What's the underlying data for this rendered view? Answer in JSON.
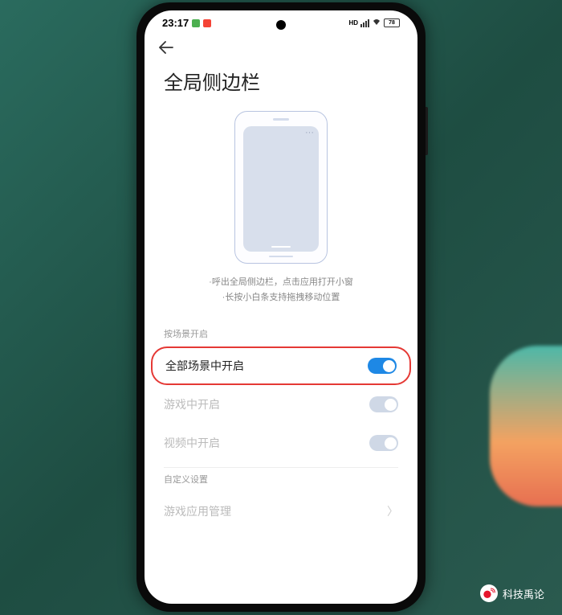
{
  "statusBar": {
    "time": "23:17",
    "battery": "78"
  },
  "page": {
    "title": "全局侧边栏"
  },
  "description": {
    "line1": "·呼出全局侧边栏，点击应用打开小窗",
    "line2": "·长按小白条支持拖拽移动位置"
  },
  "sections": {
    "sceneHeader": "按场景开启",
    "customHeader": "自定义设置"
  },
  "settings": {
    "allScenes": {
      "label": "全部场景中开启",
      "enabled": true
    },
    "gameScene": {
      "label": "游戏中开启",
      "enabled": true
    },
    "videoScene": {
      "label": "视频中开启",
      "enabled": true
    },
    "gameAppMgmt": {
      "label": "游戏应用管理"
    }
  },
  "watermark": {
    "text": "科技禹论"
  }
}
